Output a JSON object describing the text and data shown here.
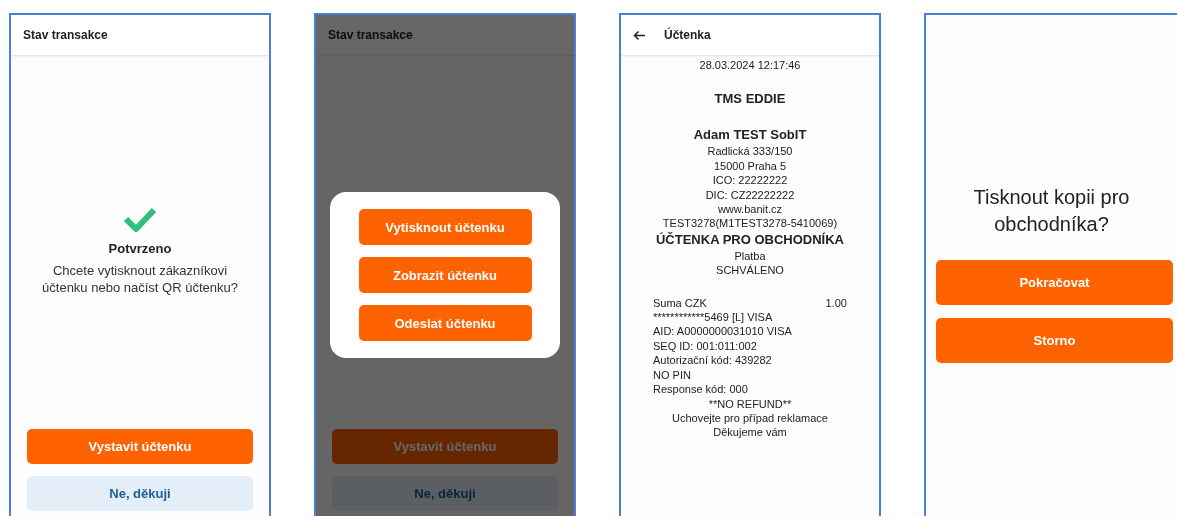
{
  "screens": [
    {
      "kind": "status",
      "dimmed": false,
      "title": "Stav transakce",
      "status_heading": "Potvrzeno",
      "message": "Chcete vytisknout zákazníkovi účtenku nebo načíst QR účtenku?",
      "buttons": [
        {
          "label": "Vystavit účtenku",
          "kind": "primary"
        },
        {
          "label": "Ne, děkuji",
          "kind": "secondary"
        }
      ]
    },
    {
      "kind": "status",
      "dimmed": true,
      "title": "Stav transakce",
      "buttons": [
        {
          "label": "Vystavit účtenku",
          "kind": "primary"
        },
        {
          "label": "Ne, děkuji",
          "kind": "secondary"
        }
      ],
      "dialog": {
        "buttons": [
          {
            "label": "Vytisknout účtenku"
          },
          {
            "label": "Zobrazit účtenku"
          },
          {
            "label": "Odeslat účtenku"
          }
        ]
      }
    },
    {
      "kind": "receipt",
      "title": "Účtenka",
      "sections": [
        {
          "lines": [
            {
              "kind": "text",
              "text": "28.03.2024 12:17:46"
            }
          ]
        },
        {
          "lines": [
            {
              "kind": "heading",
              "text": "TMS EDDIE"
            }
          ]
        },
        {
          "lines": [
            {
              "kind": "heading",
              "text": "Adam TEST SobIT"
            },
            {
              "kind": "text",
              "text": "Radlická 333/150"
            },
            {
              "kind": "text",
              "text": "15000 Praha 5"
            },
            {
              "kind": "text",
              "text": "ICO: 22222222"
            },
            {
              "kind": "text",
              "text": "DIC: CZ22222222"
            },
            {
              "kind": "text",
              "text": "www.banit.cz"
            },
            {
              "kind": "text",
              "text": "TEST3278(M1TEST3278-5410069)"
            },
            {
              "kind": "heading",
              "text": "ÚČTENKA PRO OBCHODNÍKA"
            },
            {
              "kind": "text",
              "text": "Platba"
            },
            {
              "kind": "text",
              "text": "SCHVÁLENO"
            }
          ]
        },
        {
          "lines": [
            {
              "kind": "pair",
              "text": "Suma CZK",
              "value": "1.00"
            },
            {
              "kind": "left",
              "text": "************5469 [L] VISA"
            },
            {
              "kind": "left",
              "text": "AID: A0000000031010 VISA"
            },
            {
              "kind": "left",
              "text": "SEQ ID: 001:011:002"
            },
            {
              "kind": "left",
              "text": "Autorizační kód: 439282"
            },
            {
              "kind": "left",
              "text": "NO PIN"
            },
            {
              "kind": "left",
              "text": "Response kód: 000"
            },
            {
              "kind": "text",
              "text": "**NO REFUND**"
            },
            {
              "kind": "text",
              "text": "Uchovejte pro případ reklamace"
            },
            {
              "kind": "text",
              "text": "Děkujeme vám"
            }
          ]
        }
      ]
    },
    {
      "kind": "question",
      "question": "Tisknout kopii pro obchodníka?",
      "buttons": [
        {
          "label": "Pokračovat",
          "kind": "primary"
        },
        {
          "label": "Storno",
          "kind": "primary"
        }
      ]
    }
  ]
}
